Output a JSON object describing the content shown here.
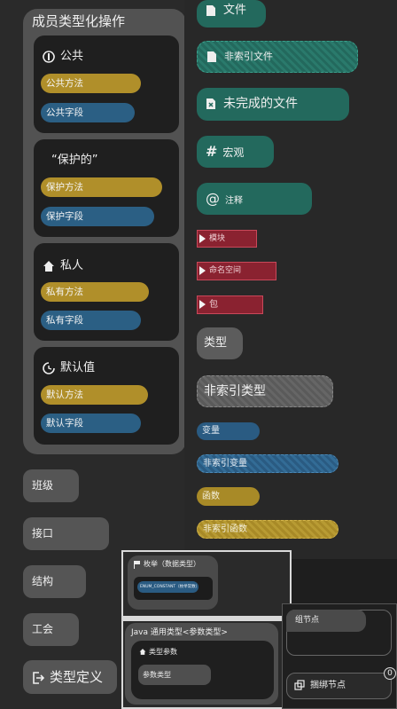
{
  "members": {
    "title": "成员类型化操作",
    "groups": [
      {
        "icon": "public-icon",
        "title": "公共",
        "method": "公共方法",
        "field": "公共字段"
      },
      {
        "icon": "",
        "title": "“保护的”",
        "method": "保护方法",
        "field": "保护字段"
      },
      {
        "icon": "house-icon",
        "title": "私人",
        "method": "私有方法",
        "field": "私有字段"
      },
      {
        "icon": "default-icon",
        "title": "默认值",
        "method": "默认方法",
        "field": "默认字段"
      }
    ]
  },
  "kinds": [
    "班级",
    "接口",
    "结构",
    "工会"
  ],
  "type_def": {
    "icon": "exit-icon",
    "label": "类型定义"
  },
  "right": {
    "file": "文件",
    "non_indexed_file": "非索引文件",
    "incomplete_file": "未完成的文件",
    "macro": "宏观",
    "annotation": "注释",
    "module": "模块",
    "namespace": "命名空间",
    "package": "包",
    "type": "类型",
    "non_indexed_type": "非索引类型",
    "variable": "变量",
    "non_indexed_variable": "非索引变量",
    "function": "函数",
    "non_indexed_function": "非索引函数"
  },
  "bottom_middle": {
    "enum_title": "枚举（数据类型）",
    "enum_constant": "ENUM_CONSTANT（枚举常数）",
    "generic_title": "Java 通用类型<参数类型>",
    "type_param_title": "类型参数",
    "param_type": "参数类型"
  },
  "bottom_right": {
    "group_node": "组节点",
    "bundle_node": "捆绑节点",
    "badge": "0"
  },
  "colors": {
    "teal": "#23695d",
    "gold": "#b08f2a",
    "blue": "#2b5f84",
    "red": "#8a2230",
    "gray": "#5c5c5c",
    "panel": "#525252"
  }
}
